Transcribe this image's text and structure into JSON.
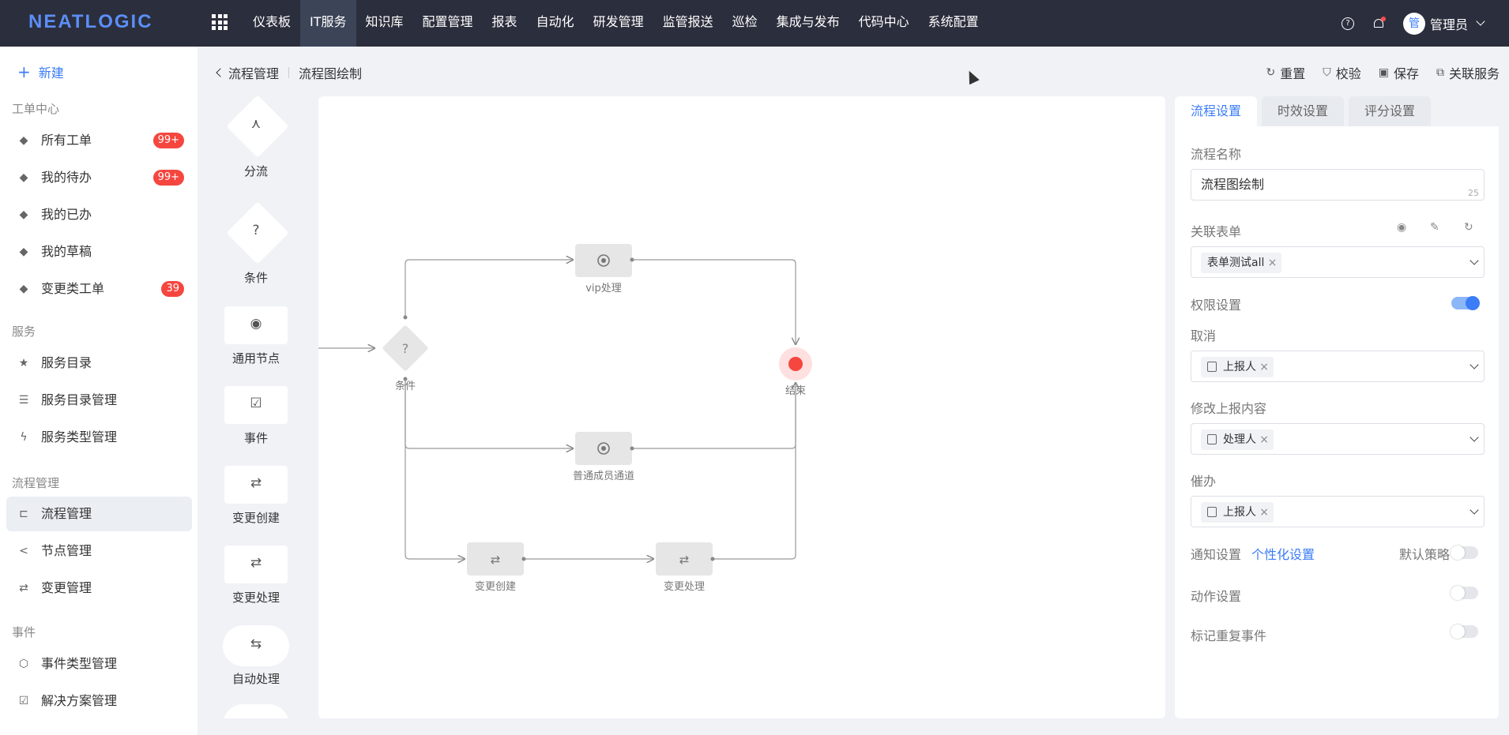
{
  "header": {
    "logo": "NEATLOGIC",
    "nav": [
      "仪表板",
      "IT服务",
      "知识库",
      "配置管理",
      "报表",
      "自动化",
      "研发管理",
      "监管报送",
      "巡检",
      "集成与发布",
      "代码中心",
      "系统配置"
    ],
    "active_nav": "IT服务",
    "avatar_text": "管",
    "user_name": "管理员"
  },
  "sidebar": {
    "new_label": "新建",
    "group_ticket": "工单中心",
    "items_ticket": [
      {
        "label": "所有工单",
        "badge": "99+"
      },
      {
        "label": "我的待办",
        "badge": "99+"
      },
      {
        "label": "我的已办",
        "badge": ""
      },
      {
        "label": "我的草稿",
        "badge": ""
      },
      {
        "label": "变更类工单",
        "badge": "39"
      }
    ],
    "group_service": "服务",
    "items_service": [
      {
        "label": "服务目录"
      },
      {
        "label": "服务目录管理"
      },
      {
        "label": "服务类型管理"
      }
    ],
    "group_flow": "流程管理",
    "items_flow": [
      {
        "label": "流程管理"
      },
      {
        "label": "节点管理"
      },
      {
        "label": "变更管理"
      }
    ],
    "group_event": "事件",
    "items_event": [
      {
        "label": "事件类型管理"
      },
      {
        "label": "解决方案管理"
      }
    ]
  },
  "breadcrumb": {
    "parent": "流程管理",
    "current": "流程图绘制"
  },
  "toolbar": {
    "reset": "重置",
    "validate": "校验",
    "save": "保存",
    "related": "关联服务"
  },
  "palette": [
    {
      "label": "分流",
      "icon": "branch-icon"
    },
    {
      "label": "条件",
      "icon": "question-icon"
    },
    {
      "label": "通用节点",
      "icon": "target-icon"
    },
    {
      "label": "事件",
      "icon": "calendar-check-icon"
    },
    {
      "label": "变更创建",
      "icon": "swap-icon"
    },
    {
      "label": "变更处理",
      "icon": "swap-icon"
    },
    {
      "label": "自动处理",
      "icon": "auto-icon"
    }
  ],
  "flow": {
    "condition_mark": "?",
    "condition_label": "条件",
    "vip_label": "vip处理",
    "normal_label": "普通成员通道",
    "change_create_label": "变更创建",
    "change_handle_label": "变更处理",
    "end_label": "结束"
  },
  "panel": {
    "tabs": [
      "流程设置",
      "时效设置",
      "评分设置"
    ],
    "name_label": "流程名称",
    "name_value": "流程图绘制",
    "name_count": "25",
    "form_label": "关联表单",
    "form_value": "表单测试all",
    "permission_label": "权限设置",
    "cancel_label": "取消",
    "cancel_value": "上报人",
    "modify_label": "修改上报内容",
    "modify_value": "处理人",
    "urge_label": "催办",
    "urge_value": "上报人",
    "notify_label": "通知设置",
    "notify_link": "个性化设置",
    "default_policy": "默认策略",
    "action_label": "动作设置",
    "mark_dup_label": "标记重复事件"
  },
  "colors": {
    "accent": "#3b7cf7",
    "topbar": "#2b2e3c",
    "badge": "#f5463f",
    "end": "#f5463f"
  }
}
